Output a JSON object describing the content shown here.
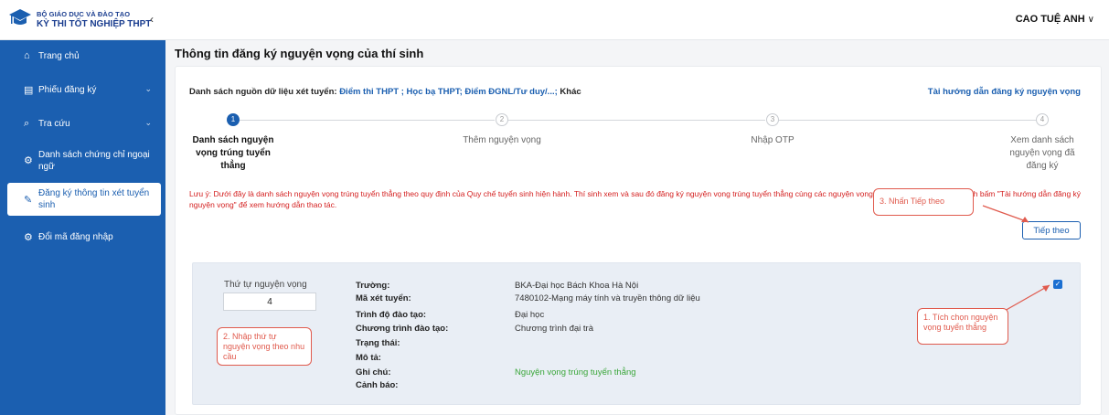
{
  "header": {
    "org_line1": "BỘ GIÁO DỤC VÀ ĐÀO TẠO",
    "org_line2": "KỲ THI TỐT NGHIỆP THPT",
    "collapse_glyph": "‹",
    "user_name": "CAO TUỆ ANH",
    "user_chevron": "∨"
  },
  "sidebar": {
    "items": [
      {
        "icon": "home-icon",
        "label": "Trang chủ"
      },
      {
        "icon": "document-icon",
        "label": "Phiếu đăng ký"
      },
      {
        "icon": "search-icon",
        "label": "Tra cứu"
      },
      {
        "icon": "gear-icon",
        "label": "Danh sách chứng chỉ ngoại ngữ"
      },
      {
        "icon": "edit-icon",
        "label": "Đăng ký thông tin xét tuyển sinh"
      },
      {
        "icon": "gear-icon",
        "label": "Đổi mã đăng nhập"
      }
    ]
  },
  "main": {
    "title": "Thông tin đăng ký nguyện vọng của thí sinh",
    "sources_prefix": "Danh sách nguồn dữ liệu xét tuyển:",
    "sources_links": "Điểm thi THPT ; Học bạ THPT; Điểm ĐGNL/Tư duy/...;",
    "sources_suffix": "Khác",
    "guide_link": "Tài hướng dẫn đăng ký nguyện vọng",
    "steps": [
      {
        "num": "1",
        "label": "Danh sách nguyện vọng trúng tuyển thẳng"
      },
      {
        "num": "2",
        "label": "Thêm nguyện vọng"
      },
      {
        "num": "3",
        "label": "Nhập OTP"
      },
      {
        "num": "4",
        "label": "Xem danh sách nguyện vọng đã đăng ký"
      }
    ],
    "note": "Lưu ý: Dưới đây là danh sách nguyện vọng trúng tuyển thẳng theo quy định của Quy chế tuyển sinh hiện hành. Thí sinh xem và sau đó đăng ký nguyện vọng trúng tuyển thẳng cùng các nguyện vọng khác theo lịch chung. Thí sinh bấm \"Tài hướng dẫn đăng ký nguyện vọng\" để xem hướng dẫn thao tác.",
    "next_button": "Tiếp theo",
    "wish": {
      "order_label": "Thứ tự nguyện vọng",
      "order_value": "4",
      "fields": [
        {
          "key": "Trường:",
          "value": "BKA-Đại học Bách Khoa Hà Nội"
        },
        {
          "key": "Mã xét tuyển:",
          "value": "7480102-Mạng máy tính và truyền thông dữ liệu"
        },
        {
          "key": "Trình độ đào tạo:",
          "value": "Đại học"
        },
        {
          "key": "Chương trình đào tạo:",
          "value": "Chương trình đại trà"
        },
        {
          "key": "Trạng thái:",
          "value": ""
        },
        {
          "key": "Mô tả:",
          "value": ""
        },
        {
          "key": "Ghi chú:",
          "value": "Nguyện vọng trúng tuyển thẳng"
        },
        {
          "key": "Cảnh báo:",
          "value": ""
        }
      ],
      "checked": true
    }
  },
  "annotations": {
    "step1": "1. Tích chọn nguyện vọng tuyển thẳng",
    "step2": "2. Nhập thứ tự nguyện vọng theo nhu cầu",
    "step3": "3. Nhấn Tiếp theo"
  },
  "colors": {
    "primary": "#1b5fb0",
    "warning_text": "#d42020",
    "callout": "#e05a4d",
    "success": "#3aa63a"
  }
}
